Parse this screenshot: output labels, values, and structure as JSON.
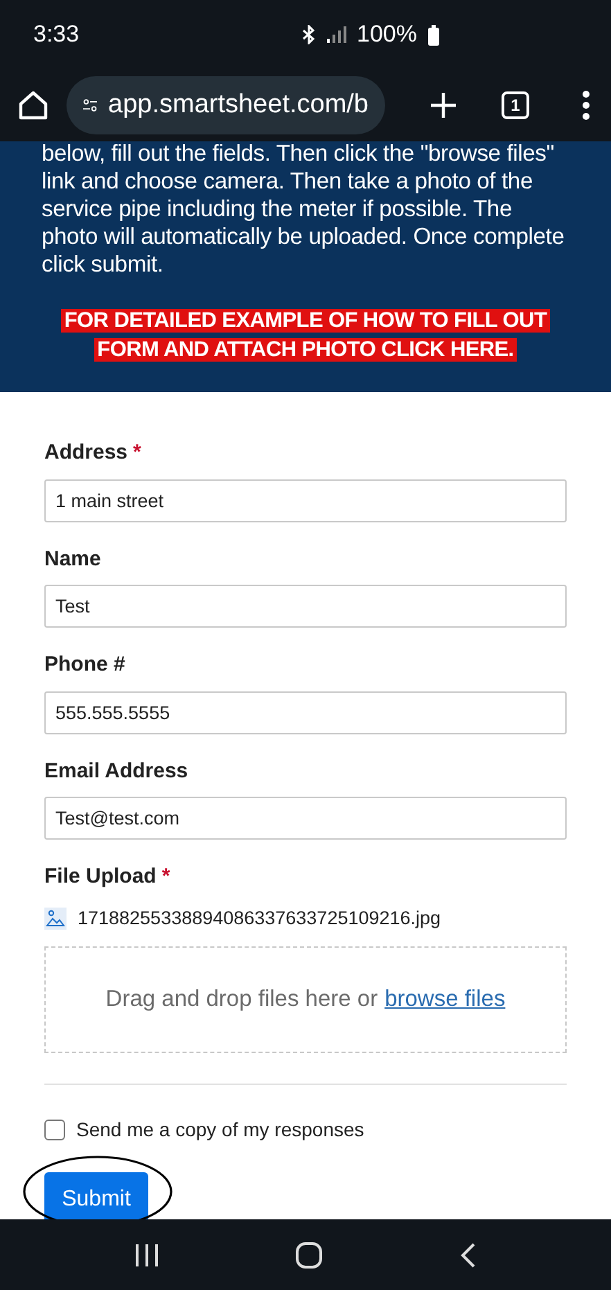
{
  "status_bar": {
    "time": "3:33",
    "battery": "100%"
  },
  "browser": {
    "url": "app.smartsheet.com/b",
    "tab_count": "1"
  },
  "banner": {
    "text": "below, fill out the fields. Then click the \"browse files\" link and choose camera. Then take a photo of the service pipe including the meter if possible. The photo will automatically be uploaded. Once complete click submit.",
    "link": "FOR DETAILED EXAMPLE OF HOW TO FILL OUT FORM AND ATTACH PHOTO CLICK HERE."
  },
  "fields": [
    {
      "label": "Address",
      "required_mark": "*",
      "value": "1 main street"
    },
    {
      "label": "Name",
      "value": "Test"
    },
    {
      "label": "Phone #",
      "value": "555.555.5555"
    },
    {
      "label": "Email Address",
      "value": "Test@test.com"
    }
  ],
  "file_upload": {
    "label": "File Upload",
    "required_mark": "*",
    "file_name": "17188255338894086337633725109216.jpg",
    "drop_text": "Drag and drop files here or",
    "browse_link": "browse files"
  },
  "copy_option": {
    "label": "Send me a copy of my responses",
    "checked": false
  },
  "submit": {
    "label": "Submit"
  }
}
